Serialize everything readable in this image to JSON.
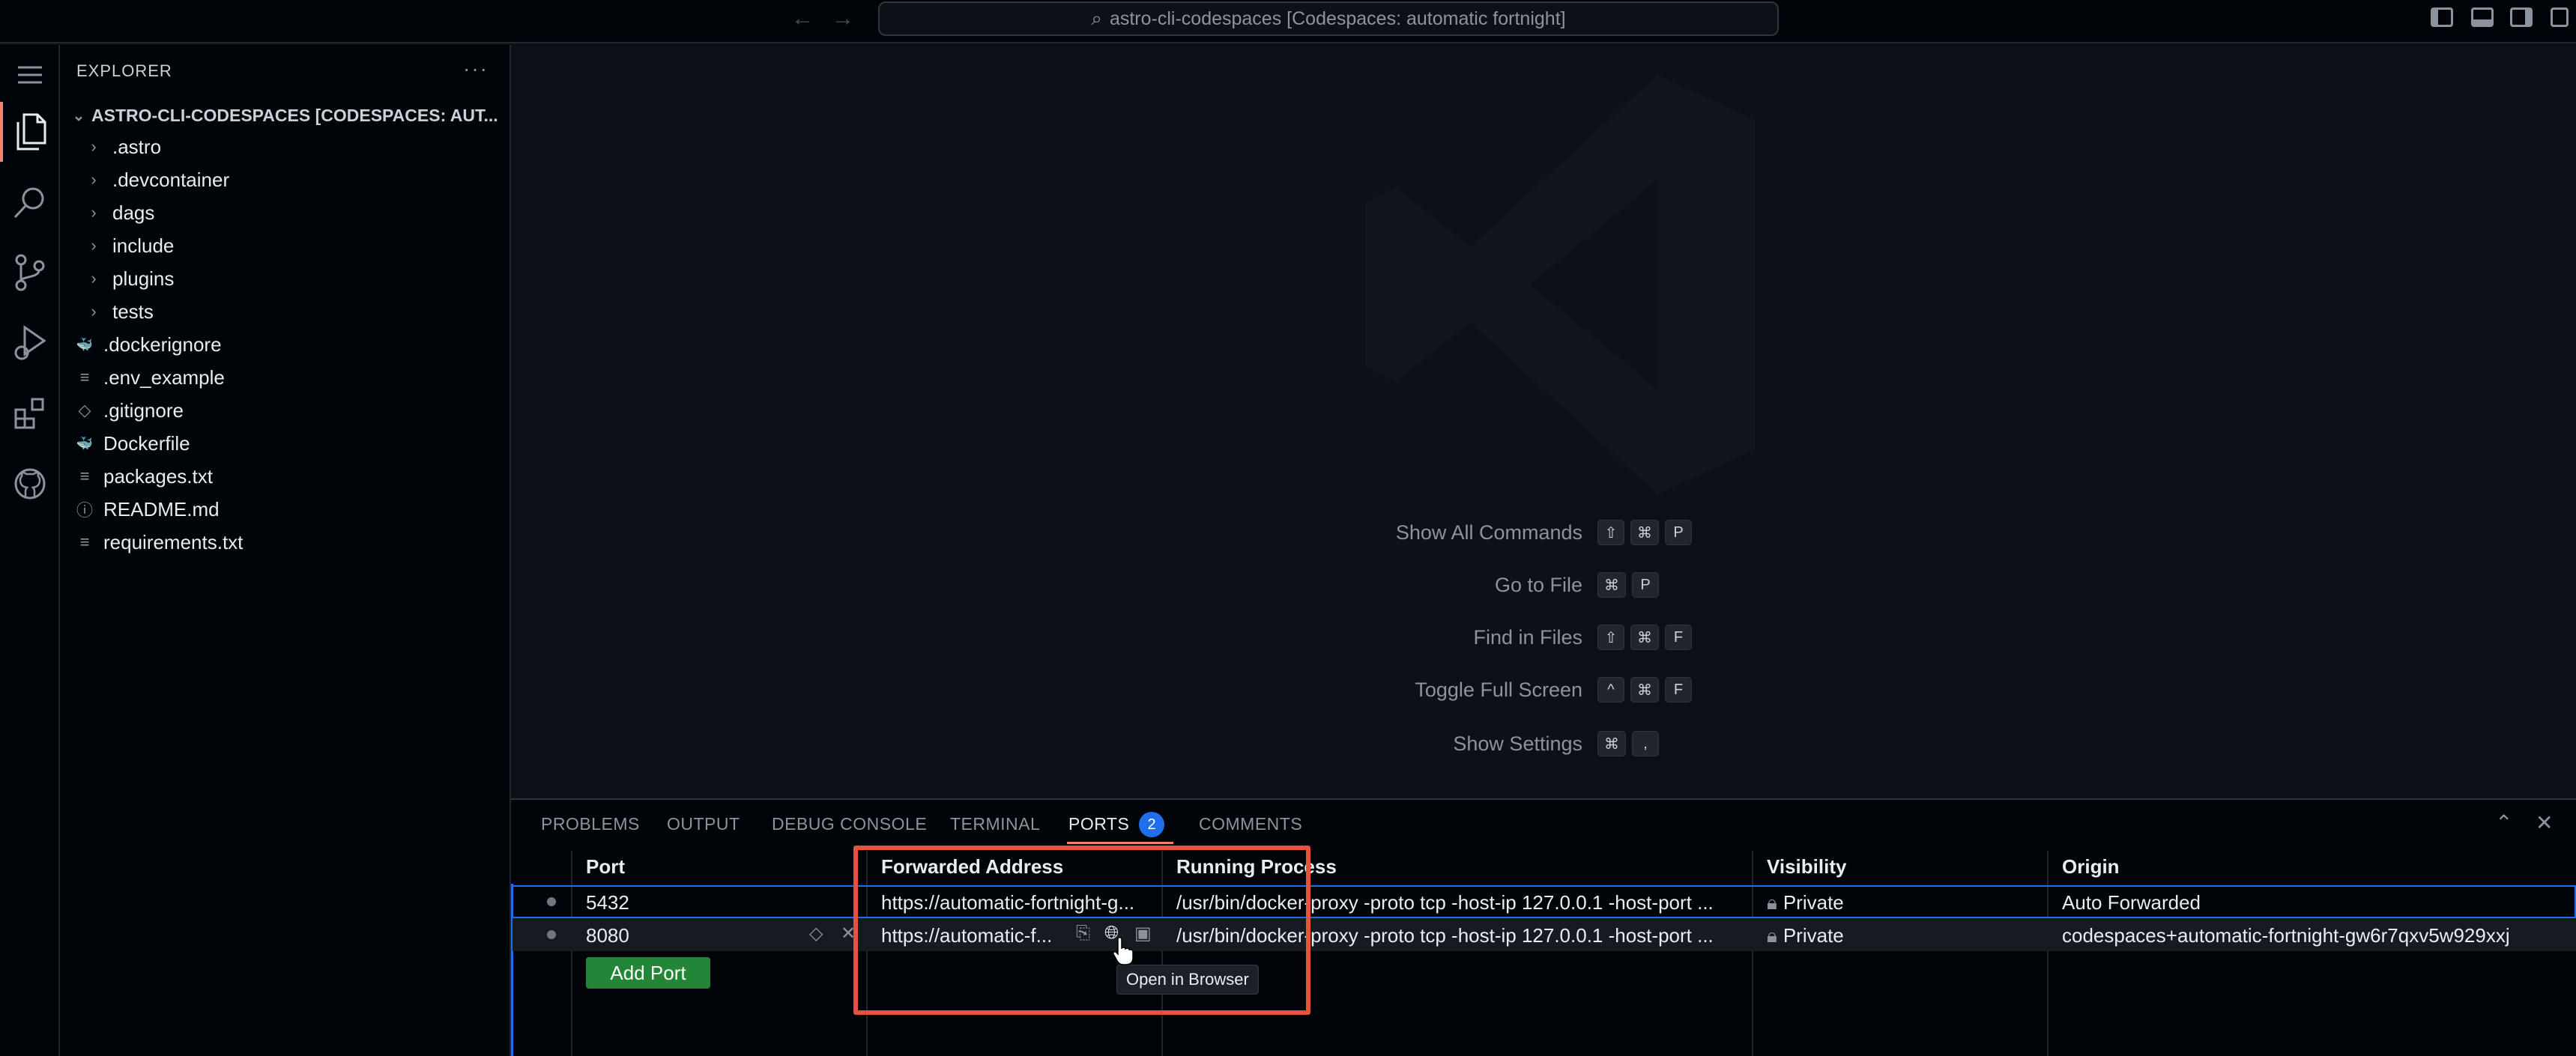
{
  "titlebar": {
    "command_center": "astro-cli-codespaces [Codespaces: automatic fortnight]"
  },
  "sidebar": {
    "title": "EXPLORER",
    "more": "···",
    "root": "ASTRO-CLI-CODESPACES [CODESPACES: AUT...",
    "items": [
      {
        "label": ".astro",
        "icon": "chevron-right-icon",
        "glyph": "›"
      },
      {
        "label": ".devcontainer",
        "icon": "chevron-right-icon",
        "glyph": "›"
      },
      {
        "label": "dags",
        "icon": "chevron-right-icon",
        "glyph": "›"
      },
      {
        "label": "include",
        "icon": "chevron-right-icon",
        "glyph": "›"
      },
      {
        "label": "plugins",
        "icon": "chevron-right-icon",
        "glyph": "›"
      },
      {
        "label": "tests",
        "icon": "chevron-right-icon",
        "glyph": "›"
      },
      {
        "label": ".dockerignore",
        "icon": "docker-icon",
        "glyph": "🐳"
      },
      {
        "label": ".env_example",
        "icon": "file-lines-icon",
        "glyph": "≡"
      },
      {
        "label": ".gitignore",
        "icon": "git-icon",
        "glyph": "◇"
      },
      {
        "label": "Dockerfile",
        "icon": "docker-icon",
        "glyph": "🐳"
      },
      {
        "label": "packages.txt",
        "icon": "file-lines-icon",
        "glyph": "≡"
      },
      {
        "label": "README.md",
        "icon": "info-icon",
        "glyph": "ⓘ"
      },
      {
        "label": "requirements.txt",
        "icon": "file-lines-icon",
        "glyph": "≡"
      }
    ]
  },
  "editor": {
    "shortcuts": [
      {
        "label": "Show All Commands",
        "keys": [
          "⇧",
          "⌘",
          "P"
        ]
      },
      {
        "label": "Go to File",
        "keys": [
          "⌘",
          "P"
        ]
      },
      {
        "label": "Find in Files",
        "keys": [
          "⇧",
          "⌘",
          "F"
        ]
      },
      {
        "label": "Toggle Full Screen",
        "keys": [
          "^",
          "⌘",
          "F"
        ]
      },
      {
        "label": "Show Settings",
        "keys": [
          "⌘",
          ","
        ]
      }
    ]
  },
  "panel": {
    "tabs": {
      "problems": "PROBLEMS",
      "output": "OUTPUT",
      "debug_console": "DEBUG CONSOLE",
      "terminal": "TERMINAL",
      "ports": "PORTS",
      "comments": "COMMENTS"
    },
    "ports_badge": "2",
    "columns": {
      "port": "Port",
      "forwarded_address": "Forwarded Address",
      "running_process": "Running Process",
      "visibility": "Visibility",
      "origin": "Origin"
    },
    "rows": [
      {
        "port": "5432",
        "address": "https://automatic-fortnight-g...",
        "process": "/usr/bin/docker-proxy -proto tcp -host-ip 127.0.0.1 -host-port ...",
        "visibility": "Private",
        "origin": "Auto Forwarded"
      },
      {
        "port": "8080",
        "address": "https://automatic-f...",
        "process": "/usr/bin/docker-proxy -proto tcp -host-ip 127.0.0.1 -host-port ...",
        "visibility": "Private",
        "origin": "codespaces+automatic-fortnight-gw6r7qxv5w929xxj"
      }
    ],
    "add_port": "Add Port",
    "tooltip": "Open in Browser"
  },
  "colors": {
    "accent": "#1f6feb",
    "highlight_box": "#e5533f",
    "add_port_button": "#238636"
  }
}
